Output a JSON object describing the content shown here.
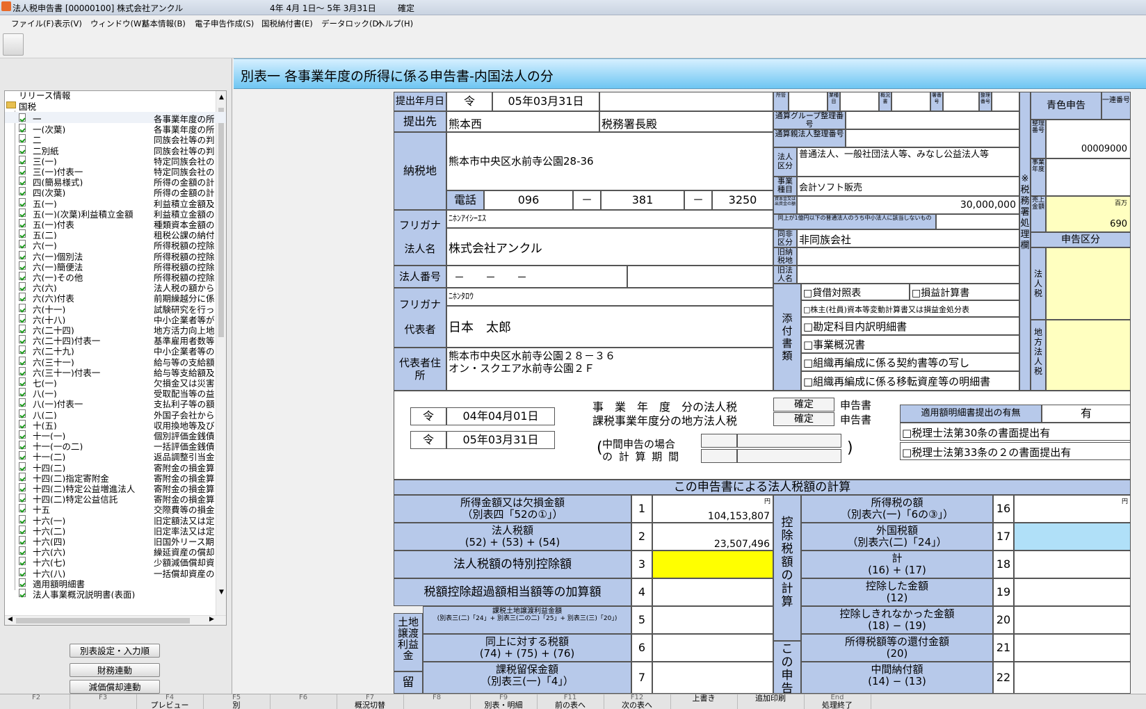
{
  "titlebar": {
    "title": "法人税申告書 [00000100] 株式会社アンクル",
    "period": "4年 4月 1日～ 5年 3月31日",
    "status": "確定"
  },
  "menu": [
    "ファイル(F)",
    "表示(V)",
    "ウィンドウ(W)",
    "基本情報(B)",
    "電子申告作成(S)",
    "国税納付書(E)",
    "データロック(D)",
    "ヘルプ(H)"
  ],
  "tree": {
    "root": "リリース情報",
    "group": "国税",
    "items": [
      {
        "n": "一",
        "d": "各事業年度の所"
      },
      {
        "n": "一(次葉)",
        "d": "各事業年度の所"
      },
      {
        "n": "二",
        "d": "同族会社等の判"
      },
      {
        "n": "二別紙",
        "d": "同族会社等の判"
      },
      {
        "n": "三(一)",
        "d": "特定同族会社の"
      },
      {
        "n": "三(一)付表一",
        "d": "特定同族会社の"
      },
      {
        "n": "四(簡易様式)",
        "d": "所得の金額の計"
      },
      {
        "n": "四(次葉)",
        "d": "所得の金額の計"
      },
      {
        "n": "五(一)",
        "d": "利益積立金額及"
      },
      {
        "n": "五(一)(次葉)利益積立金額",
        "d": "利益積立金額の"
      },
      {
        "n": "五(一)付表",
        "d": "種類資本金額の"
      },
      {
        "n": "五(二)",
        "d": "租税公課の納付"
      },
      {
        "n": "六(一)",
        "d": "所得税額の控除"
      },
      {
        "n": "六(一)個別法",
        "d": "所得税額の控除"
      },
      {
        "n": "六(一)簡便法",
        "d": "所得税額の控除"
      },
      {
        "n": "六(一)その他",
        "d": "所得税額の控除"
      },
      {
        "n": "六(六)",
        "d": "法人税の額から"
      },
      {
        "n": "六(六)付表",
        "d": "前期繰越分に係"
      },
      {
        "n": "六(十一)",
        "d": "試験研究を行っ"
      },
      {
        "n": "六(十八)",
        "d": "中小企業者等が"
      },
      {
        "n": "六(二十四)",
        "d": "地方活力向上地"
      },
      {
        "n": "六(二十四)付表一",
        "d": "基準雇用者数等"
      },
      {
        "n": "六(二十九)",
        "d": "中小企業者等の"
      },
      {
        "n": "六(三十一)",
        "d": "給与等の支給額"
      },
      {
        "n": "六(三十一)付表一",
        "d": "給与等支給額及"
      },
      {
        "n": "七(一)",
        "d": "欠損金又は災害"
      },
      {
        "n": "八(一)",
        "d": "受取配当等の益"
      },
      {
        "n": "八(一)付表一",
        "d": "支払利子等の額"
      },
      {
        "n": "八(二)",
        "d": "外国子会社から"
      },
      {
        "n": "十(五)",
        "d": "収用換地等及び"
      },
      {
        "n": "十一(一)",
        "d": "個別評価金銭債"
      },
      {
        "n": "十一(一の二)",
        "d": "一括評価金銭債"
      },
      {
        "n": "十一(二)",
        "d": "返品調整引当金"
      },
      {
        "n": "十四(二)",
        "d": "寄附金の損金算"
      },
      {
        "n": "十四(二)指定寄附金",
        "d": "寄附金の損金算"
      },
      {
        "n": "十四(二)特定公益増進法人",
        "d": "寄附金の損金算"
      },
      {
        "n": "十四(二)特定公益信託",
        "d": "寄附金の損金算"
      },
      {
        "n": "十五",
        "d": "交際費等の損金"
      },
      {
        "n": "十六(一)",
        "d": "旧定額法又は定"
      },
      {
        "n": "十六(二)",
        "d": "旧定率法又は定"
      },
      {
        "n": "十六(四)",
        "d": "旧国外リース期"
      },
      {
        "n": "十六(六)",
        "d": "繰延資産の償却"
      },
      {
        "n": "十六(七)",
        "d": "少額減価償却資"
      },
      {
        "n": "十六(八)",
        "d": "一括償却資産の"
      },
      {
        "n": "適用額明細書",
        "d": ""
      },
      {
        "n": "法人事業概況説明書(表面)",
        "d": ""
      }
    ]
  },
  "buttons": {
    "b1": "別表設定・入力順",
    "b2": "財務連動",
    "b3": "減価償却連動"
  },
  "form": {
    "title": "別表一 各事業年度の所得に係る申告書-内国法人の分",
    "submit_label": "提出年月日",
    "era": "令",
    "submit_date": "05年03月31日",
    "dest_label": "提出先",
    "dest": "熊本西",
    "dest_suffix": "税務署長殿",
    "addr_label": "納税地",
    "addr": "熊本市中央区水前寺公園28-36",
    "tel_label": "電話",
    "tel1": "096",
    "tel2": "381",
    "tel3": "3250",
    "dash": "－",
    "furigana_label": "フリガナ",
    "corp_kana": "ﾆﾎﾝｱｲｼｰｴｽ",
    "corp_label": "法人名",
    "corp_name": "株式会社アンクル",
    "num_label": "法人番号",
    "corp_num": "－　　－　　－",
    "rep_kana": "ﾆﾎﾝﾀﾛｳ",
    "rep_label": "代表者",
    "rep_name": "日本　太郎",
    "rep_addr_label": "代表者住所",
    "rep_addr1": "熊本市中央区水前寺公園２８－３６",
    "rep_addr2": "オン・スクエア水前寺公園２Ｆ",
    "tiny_heads": [
      "所管",
      "業種目",
      "概況書",
      "署番号",
      "整理番号"
    ],
    "grp_label1": "通算グループ整理番号",
    "grp_label2": "通算親法人整理番号",
    "corp_class_label": "法人区分",
    "corp_class": "普通法人、一般社団法人等、みなし公益法人等",
    "business_label": "事業種目",
    "business": "会計ソフト販売",
    "capital_label": "資本金又は出資金の額",
    "capital": "30,000,000",
    "capital_note": "同上が1億円以下の普通法人のうち中小法人に該当しないもの",
    "family_label": "同非区分",
    "family": "非同族会社",
    "old_tax_label": "旧納税地",
    "old_name_label": "旧法人名",
    "attach_label": "添付書類",
    "attach": [
      "□貸借対照表",
      "□損益計算書",
      "□株主(社員)資本等変動計算書又は損益金処分表",
      "□勘定科目内訳明細書",
      "□事業概況書",
      "□組織再編成に係る契約書等の写し",
      "□組織再編成に係る移転資産等の明細書"
    ],
    "blue_label": "青色申告",
    "serial_label": "一連番号",
    "seiri_label": "整理番号",
    "seiri": "00009000",
    "jigyo_label": "事業年度",
    "office_label": "※税務署処理欄",
    "sales_label": "売上金額",
    "sales_unit": "百万",
    "sales": "690",
    "shinkoku_label": "申告区分",
    "houjinzei_label": "法人税",
    "chihou_label": "地方法人税",
    "period_era": "令",
    "period_from": "04年04月01日",
    "period_to": "05年03月31日",
    "period_text1": "事　業　年　度　分の法人税",
    "period_text2": "課税事業年度分の地方法人税",
    "kakutei": "確定",
    "shinkokusho": "申告書",
    "interim_label1": "中間申告の場合",
    "interim_label2": "の 計 算 期 間",
    "tekiyo_label": "適用額明細書提出の有無",
    "tekiyo": "有",
    "zeirishi30": "□税理士法第30条の書面提出有",
    "zeirishi33": "□税理士法第33条の２の書面提出有",
    "calc_title": "この申告書による法人税額の計算",
    "yen": "円",
    "rows_left": [
      {
        "l1": "所得金額又は欠損金額",
        "l2": "（別表四「52の①」）",
        "no": "1",
        "val": "104,153,807"
      },
      {
        "l1": "法人税額",
        "l2": "(52) + (53) + (54)",
        "no": "2",
        "val": "23,507,496"
      },
      {
        "l1": "法人税額の特別控除額",
        "l2": "",
        "no": "3",
        "val": ""
      },
      {
        "l1": "税額控除超過額相当額等の加算額",
        "l2": "",
        "no": "4",
        "val": ""
      },
      {
        "l1": "課税土地譲渡利益金額",
        "l2": "(別表三(二)「24」+ 別表三(二の二)「25」+ 別表三(三)「20」)",
        "no": "5",
        "val": ""
      },
      {
        "l1": "同上に対する税額",
        "l2": "(74) + (75) + (76)",
        "no": "6",
        "val": ""
      },
      {
        "l1": "課税留保金額",
        "l2": "（別表三(一)「4」）",
        "no": "7",
        "val": ""
      }
    ],
    "land_label": "土地譲渡利益金",
    "ryuho_label": "留",
    "kojo_label": "控除税額の計算",
    "kono_label": "この申告",
    "rows_right": [
      {
        "l1": "所得税の額",
        "l2": "（別表六(一)「6の③」）",
        "no": "16"
      },
      {
        "l1": "外国税額",
        "l2": "（別表六(二)「24」）",
        "no": "17"
      },
      {
        "l1": "計",
        "l2": "(16) + (17)",
        "no": "18"
      },
      {
        "l1": "控除した金額",
        "l2": "(12)",
        "no": "19"
      },
      {
        "l1": "控除しきれなかった金額",
        "l2": "(18) − (19)",
        "no": "20"
      },
      {
        "l1": "所得税額等の還付金額",
        "l2": "(20)",
        "no": "21"
      },
      {
        "l1": "中間納付額",
        "l2": "(14) − (13)",
        "no": "22"
      }
    ]
  },
  "fkeys": [
    {
      "k": "F2",
      "l": ""
    },
    {
      "k": "F3",
      "l": ""
    },
    {
      "k": "F4",
      "l": "プレビュー"
    },
    {
      "k": "F5",
      "l": "別"
    },
    {
      "k": "F6",
      "l": ""
    },
    {
      "k": "F7",
      "l": "概況切替"
    },
    {
      "k": "F8",
      "l": ""
    },
    {
      "k": "F9",
      "l": "別表・明細"
    },
    {
      "k": "F11",
      "l": "前の表へ"
    },
    {
      "k": "F12",
      "l": "次の表へ"
    },
    {
      "k": "",
      "l": "上書き"
    },
    {
      "k": "",
      "l": "追加印刷"
    },
    {
      "k": "End",
      "l": "処理終了"
    }
  ]
}
